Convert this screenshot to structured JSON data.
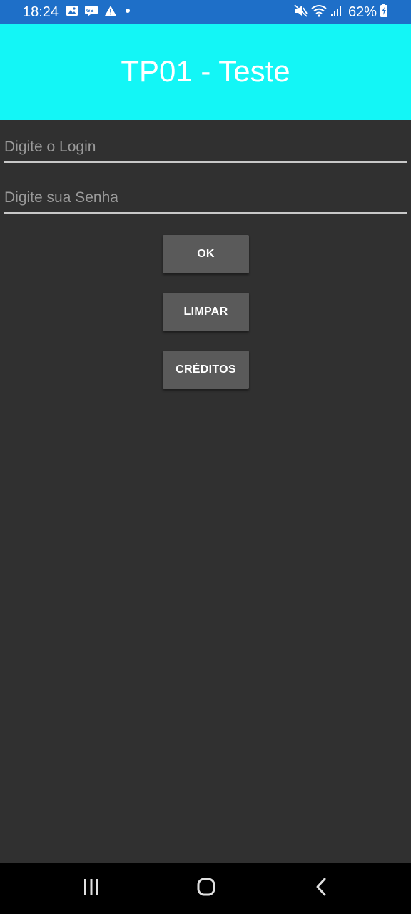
{
  "status_bar": {
    "time": "18:24",
    "battery": "62%",
    "icons_left": [
      "gallery-icon",
      "rcs-icon",
      "warning-icon",
      "dot-icon"
    ],
    "icons_right": [
      "mute-icon",
      "wifi-icon",
      "signal-icon",
      "battery-icon"
    ]
  },
  "app_bar": {
    "title": "TP01 - Teste",
    "color": "#13f6f6"
  },
  "form": {
    "login_placeholder": "Digite o Login",
    "login_value": "",
    "senha_placeholder": "Digite sua Senha",
    "senha_value": ""
  },
  "buttons": {
    "ok": "OK",
    "limpar": "LIMPAR",
    "creditos": "CRÉDITOS"
  },
  "nav_bar": {
    "icons": [
      "recents-icon",
      "home-icon",
      "back-icon"
    ]
  },
  "colors": {
    "status_bar": "#1e6fc8",
    "background": "#303030",
    "button": "#5a5a5a"
  }
}
